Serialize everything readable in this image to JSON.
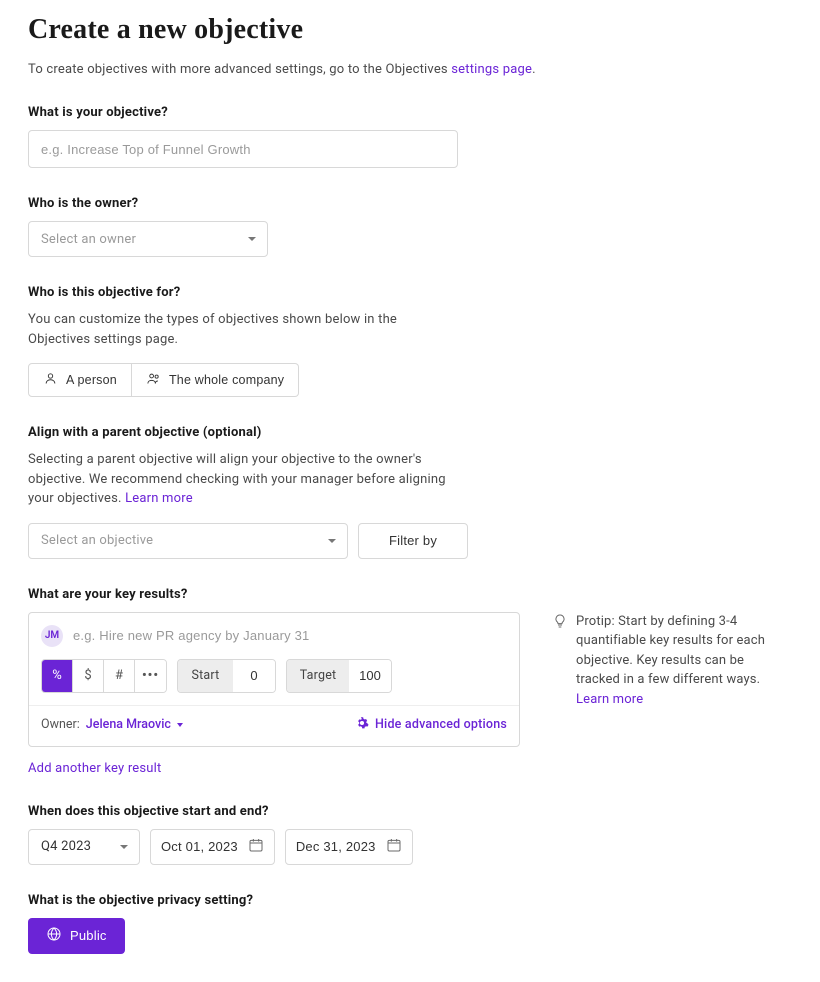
{
  "title": "Create a new objective",
  "intro": {
    "prefix": "To create objectives with more advanced settings, go to the Objectives ",
    "link": "settings page",
    "suffix": "."
  },
  "objective": {
    "label": "What is your objective?",
    "placeholder": "e.g. Increase Top of Funnel Growth"
  },
  "owner": {
    "label": "Who is the owner?",
    "placeholder": "Select an owner"
  },
  "for": {
    "label": "Who is this objective for?",
    "hint": "You can customize the types of objectives shown below in the Objectives settings page.",
    "person": "A person",
    "company": "The whole company"
  },
  "align": {
    "label": "Align with a parent objective (optional)",
    "hint_pre": "Selecting a parent objective will align your objective to the owner's objective. We recommend checking with your manager before aligning your objectives. ",
    "learn": "Learn more",
    "placeholder": "Select an objective",
    "filter": "Filter by"
  },
  "kr": {
    "label": "What are your key results?",
    "avatar_initials": "JM",
    "placeholder": "e.g. Hire new PR agency by January 31",
    "types": {
      "percent": "%",
      "currency": "$",
      "number": "#",
      "more": "•••"
    },
    "start_label": "Start",
    "start_value": "0",
    "target_label": "Target",
    "target_value": "100",
    "owner_prefix": "Owner:",
    "owner_name": "Jelena Mraovic",
    "advanced": "Hide advanced options",
    "add": "Add another key result"
  },
  "protip": {
    "text": "Protip: Start by defining 3-4 quantifiable key results for each objective. Key results can be tracked in a few different ways. ",
    "learn": "Learn more"
  },
  "dates": {
    "label": "When does this objective start and end?",
    "quarter": "Q4 2023",
    "start": "Oct 01, 2023",
    "end": "Dec 31, 2023"
  },
  "privacy": {
    "label": "What is the objective privacy setting?",
    "button": "Public"
  }
}
